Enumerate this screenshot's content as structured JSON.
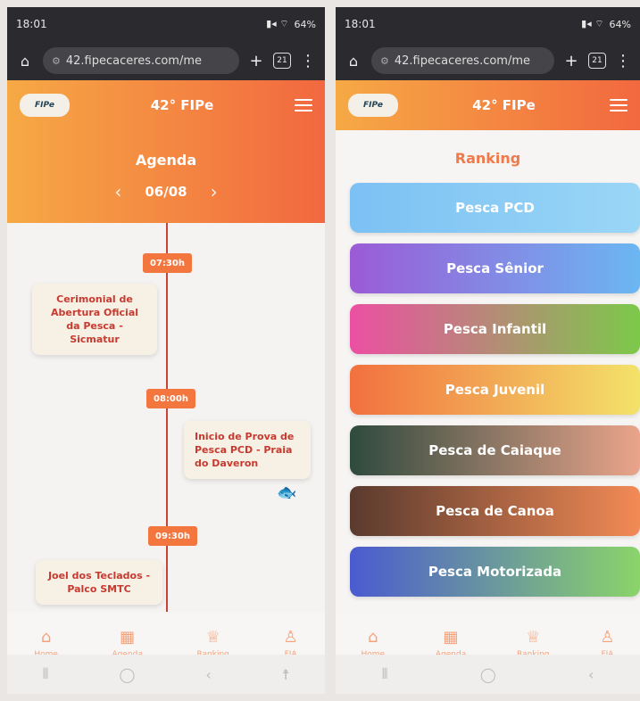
{
  "left": {
    "status": {
      "time": "18:01",
      "battery": "64%"
    },
    "url": "42.fipecaceres.com/me",
    "tabs_count": "21",
    "app": {
      "logo": "FIPe",
      "title": "42° FIPe"
    },
    "agenda": {
      "title": "Agenda",
      "date": "06/08",
      "events": [
        {
          "time": "07:30h",
          "text": "Cerimonial de Abertura Oficial da Pesca - Sicmatur"
        },
        {
          "time": "08:00h",
          "text": "Inicio de Prova de Pesca PCD - Praia do Daveron"
        },
        {
          "time": "09:30h",
          "text": "Joel dos Teclados - Palco SMTC"
        }
      ]
    },
    "nav": [
      {
        "label": "Home",
        "icon": "home-icon"
      },
      {
        "label": "Agenda",
        "icon": "calendar-icon"
      },
      {
        "label": "Ranking",
        "icon": "trophy-icon"
      },
      {
        "label": "FIA",
        "icon": "cup-icon"
      }
    ]
  },
  "right": {
    "status": {
      "time": "18:01",
      "battery": "64%"
    },
    "url": "42.fipecaceres.com/me",
    "tabs_count": "21",
    "app": {
      "logo": "FIPe",
      "title": "42° FIPe"
    },
    "ranking": {
      "title": "Ranking",
      "items": [
        {
          "label": "Pesca PCD",
          "colors": [
            "#7cc1f4",
            "#9ad6f6"
          ]
        },
        {
          "label": "Pesca Sênior",
          "colors": [
            "#9b5bd6",
            "#6bb7f2"
          ]
        },
        {
          "label": "Pesca Infantil",
          "colors": [
            "#ec4fa2",
            "#7cc94a"
          ]
        },
        {
          "label": "Pesca Juvenil",
          "colors": [
            "#f2703f",
            "#f3e26a"
          ]
        },
        {
          "label": "Pesca de Caiaque",
          "colors": [
            "#2f4a3e",
            "#eaa48b"
          ]
        },
        {
          "label": "Pesca de Canoa",
          "colors": [
            "#5a3a2e",
            "#f28a55"
          ]
        },
        {
          "label": "Pesca Motorizada",
          "colors": [
            "#4a5bd0",
            "#8bd46a"
          ]
        }
      ]
    },
    "nav": [
      {
        "label": "Home",
        "icon": "home-icon"
      },
      {
        "label": "Agenda",
        "icon": "calendar-icon"
      },
      {
        "label": "Ranking",
        "icon": "trophy-icon"
      },
      {
        "label": "FIA",
        "icon": "cup-icon"
      }
    ]
  }
}
